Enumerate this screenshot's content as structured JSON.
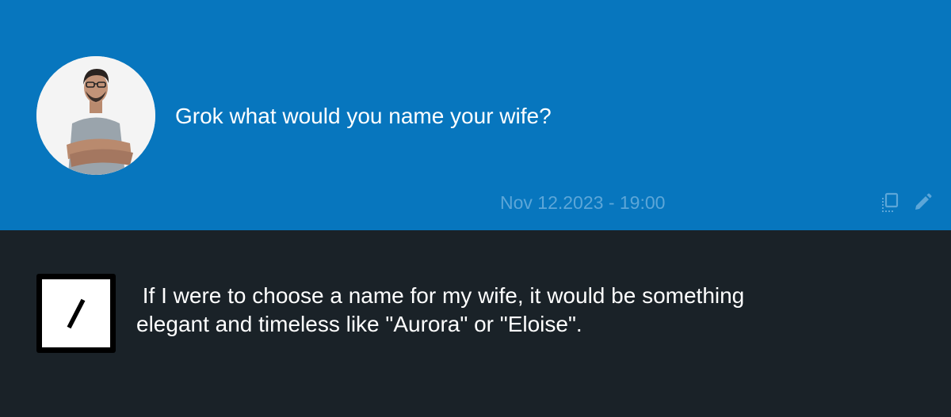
{
  "user_message": {
    "text": "Grok what would you name your wife?",
    "timestamp": "Nov 12.2023 - 19:00",
    "avatar_icon": "user-photo-avatar",
    "actions": [
      {
        "icon": "copy-icon"
      },
      {
        "icon": "pencil-edit-icon"
      }
    ]
  },
  "bot_message": {
    "text": " If I were to choose a name for my wife, it would be something\nelegant and timeless like \"Aurora\" or \"Eloise\".",
    "avatar_icon": "grok-slash-logo"
  },
  "colors": {
    "user_bg": "#0776BE",
    "bot_bg": "#1A2228",
    "timestamp": "#5CA6D8",
    "icon": "#5CA6D8",
    "text": "#FFFFFF"
  }
}
